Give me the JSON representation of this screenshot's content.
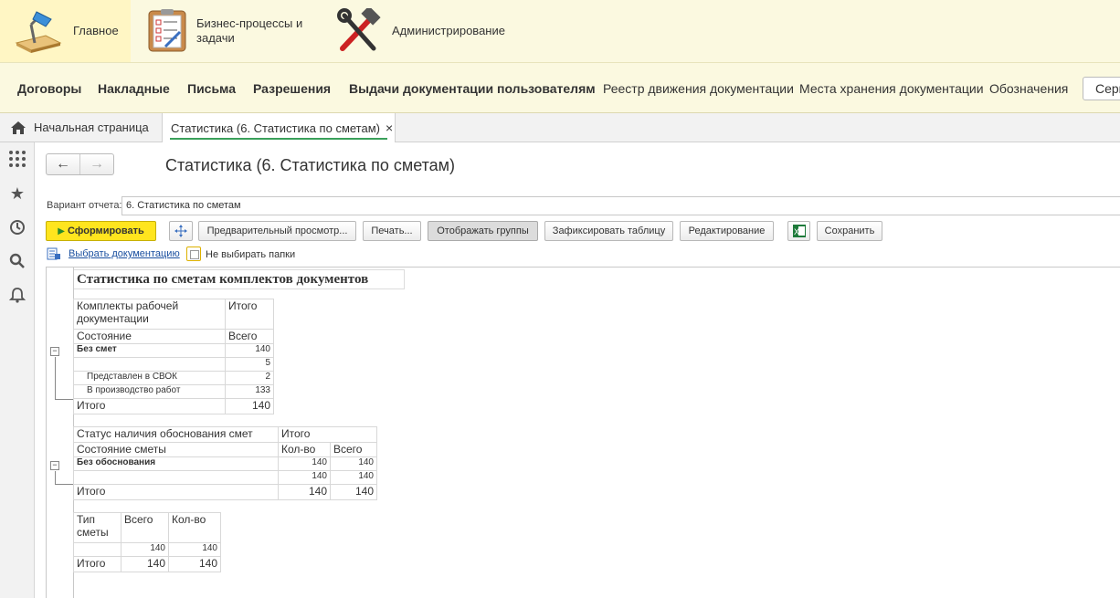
{
  "sections": [
    {
      "label": "Главное",
      "icon": "desk-lamp-icon",
      "active": true
    },
    {
      "label": "Бизнес-процессы и задачи",
      "icon": "checklist-icon",
      "active": false
    },
    {
      "label": "Администрирование",
      "icon": "hammer-wrench-icon",
      "active": false
    }
  ],
  "functions": {
    "contracts": "Договоры",
    "waybills": "Накладные",
    "letters": "Письма",
    "permits": "Разрешения",
    "issues": "Выдачи документации пользователям",
    "registry": "Реестр движения документации",
    "storage": "Места хранения документации",
    "designations": "Обозначения",
    "more": "Серв"
  },
  "tabs": {
    "home": "Начальная страница",
    "current": "Статистика (6. Статистика по сметам)",
    "close": "×"
  },
  "form": {
    "title": "Статистика (6. Статистика по сметам)",
    "variant_label": "Вариант отчета:",
    "variant_value": "6. Статистика по сметам",
    "buttons": {
      "generate": "Сформировать",
      "preview": "Предварительный просмотр...",
      "print": "Печать...",
      "groups": "Отображать группы",
      "fix_table": "Зафиксировать таблицу",
      "edit": "Редактирование",
      "save": "Сохранить"
    },
    "pick_link": "Выбрать документацию",
    "no_folders": "Не выбирать папки"
  },
  "report": {
    "title": "Статистика по сметам комплектов документов",
    "t1": {
      "h1": "Комплекты рабочей документации",
      "h1_total": "Итого",
      "h2": "Состояние",
      "h2_total": "Всего",
      "group": "Без смет",
      "group_value": "140",
      "rows": [
        {
          "label": "",
          "value": "5"
        },
        {
          "label": "Представлен в СВОК",
          "value": "2"
        },
        {
          "label": "В производство работ",
          "value": "133"
        }
      ],
      "total_label": "Итого",
      "total_value": "140"
    },
    "t2": {
      "h1": "Статус наличия обоснования смет",
      "h1_total": "Итого",
      "h2": "Состояние сметы",
      "h2_c1": "Кол-во",
      "h2_c2": "Всего",
      "group": "Без обоснования",
      "group_c1": "140",
      "group_c2": "140",
      "row_c1": "140",
      "row_c2": "140",
      "total_label": "Итого",
      "total_c1": "140",
      "total_c2": "140"
    },
    "t3": {
      "h1": "Тип сметы",
      "h_c1": "Всего",
      "h_c2": "Кол-во",
      "row_c1": "140",
      "row_c2": "140",
      "total_label": "Итого",
      "total_c1": "140",
      "total_c2": "140"
    }
  }
}
